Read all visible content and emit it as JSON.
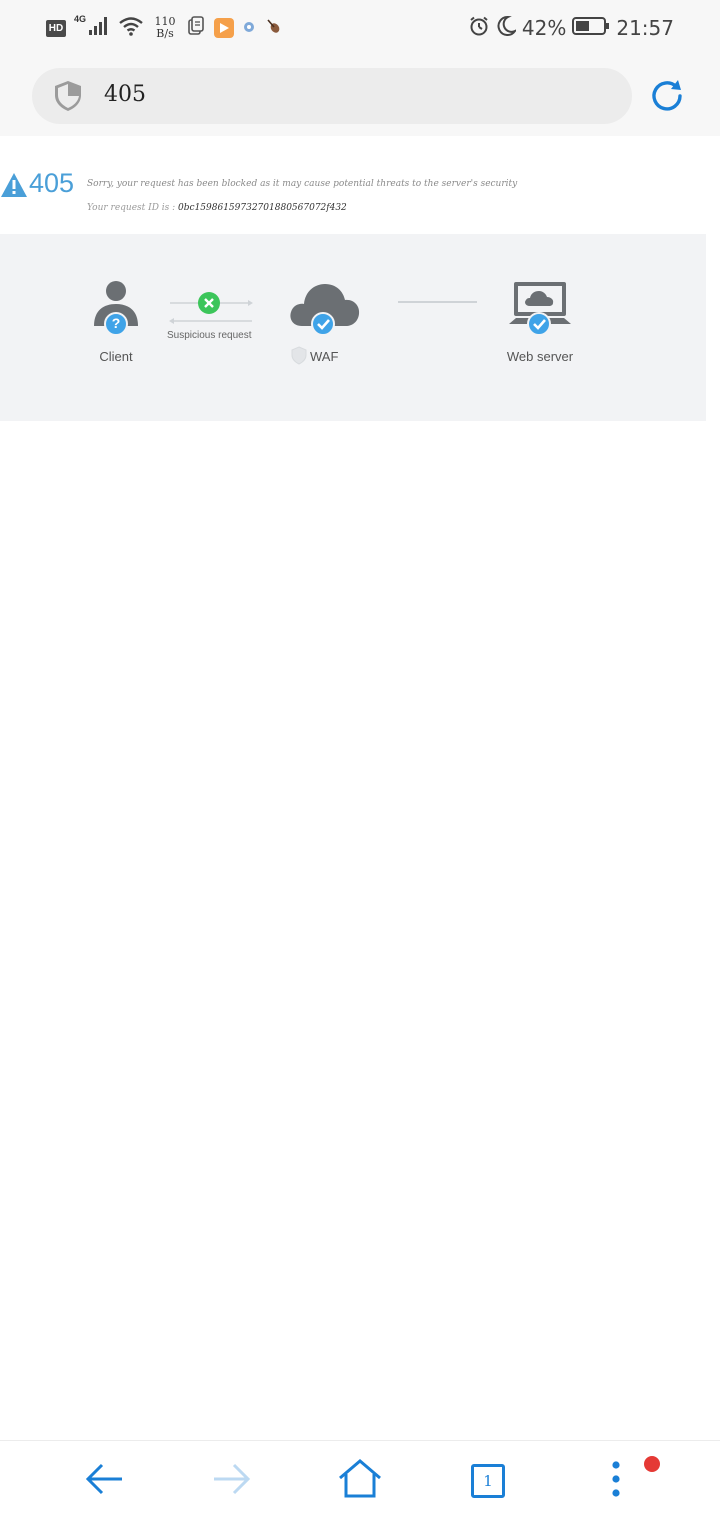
{
  "status_bar": {
    "hd": "HD",
    "network": "4G",
    "speed_value": "110",
    "speed_unit": "B/s",
    "battery_percent": "42%",
    "time": "21:57"
  },
  "address_bar": {
    "url": "405"
  },
  "error_page": {
    "code": "405",
    "message": "Sorry, your request has been blocked as it may cause potential threats to the server's security",
    "request_id_label": "Your request ID is :",
    "request_id": "0bc15986159732701880567072f432"
  },
  "diagram": {
    "client_label": "Client",
    "client_badge": "?",
    "suspicious_label": "Suspicious request",
    "waf_label": "WAF",
    "server_label": "Web server"
  },
  "bottom_nav": {
    "tab_count": "1"
  },
  "colors": {
    "accent_blue": "#4a9fd8",
    "nav_blue": "#1a7fd6",
    "green": "#3cc55a",
    "badge_blue": "#3fa3e8",
    "icon_gray": "#6b6f73",
    "notification_red": "#e53935"
  },
  "icons": [
    "shield-icon",
    "reload-icon",
    "warning-icon",
    "client-icon",
    "cloud-icon",
    "laptop-icon",
    "back-arrow-icon",
    "forward-arrow-icon",
    "home-icon",
    "tabs-icon",
    "more-icon"
  ]
}
